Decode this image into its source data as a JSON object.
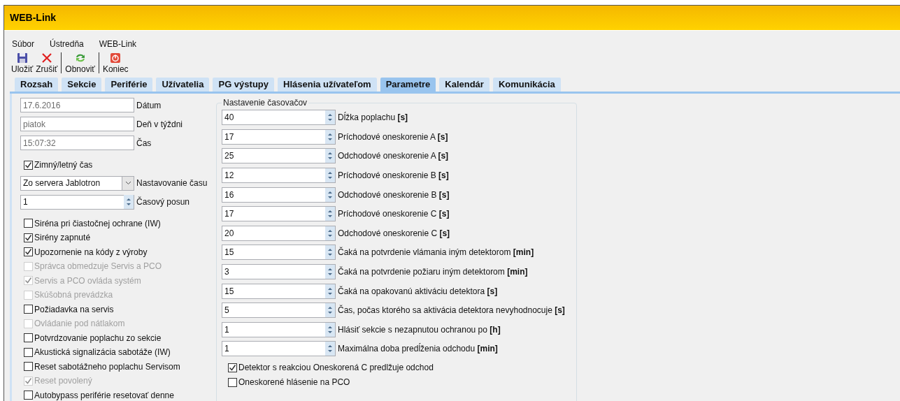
{
  "window": {
    "title": "WEB-Link"
  },
  "menu": [
    "Súbor",
    "Ústredňa",
    "WEB-Link"
  ],
  "toolbar": [
    {
      "kind": "save",
      "label": "Uložiť"
    },
    {
      "kind": "cancel",
      "label": "Zrušiť"
    },
    {
      "kind": "refresh",
      "label": "Obnoviť"
    },
    {
      "kind": "exit",
      "label": "Koniec"
    }
  ],
  "tabs": [
    {
      "label": "Rozsah",
      "selected": false
    },
    {
      "label": "Sekcie",
      "selected": false
    },
    {
      "label": "Periférie",
      "selected": false
    },
    {
      "label": "Užívatelia",
      "selected": false
    },
    {
      "label": "PG výstupy",
      "selected": false
    },
    {
      "label": "Hlásenia užívateľom",
      "selected": false
    },
    {
      "label": "Parametre",
      "selected": true
    },
    {
      "label": "Kalendár",
      "selected": false
    },
    {
      "label": "Komunikácia",
      "selected": false
    }
  ],
  "left": {
    "fields": [
      {
        "value": "17.6.2016",
        "label": "Dátum",
        "disabled": true
      },
      {
        "value": "piatok",
        "label": "Deň v týždni",
        "disabled": true
      },
      {
        "value": "15:07:32",
        "label": "Čas",
        "disabled": true
      }
    ],
    "dst": {
      "label": "Zimný/letný čas",
      "checked": true
    },
    "time_sync": {
      "value": "Zo servera Jablotron",
      "label": "Nastavovanie času"
    },
    "time_offset": {
      "value": "1",
      "label": "Časový posun"
    },
    "options": [
      {
        "kind": "checkbox",
        "label": "Siréna pri čiastočnej ochrane (IW)",
        "checked": false,
        "disabled": false
      },
      {
        "kind": "checkbox",
        "label": "Sirény zapnuté",
        "checked": true,
        "disabled": false
      },
      {
        "kind": "checkbox",
        "label": "Upozornenie na kódy z výroby",
        "checked": true,
        "disabled": false
      },
      {
        "kind": "checkbox",
        "label": "Správca obmedzuje Servis a PCO",
        "checked": false,
        "disabled": true
      },
      {
        "kind": "checkbox",
        "label": "Servis a PCO ovláda systém",
        "checked": true,
        "disabled": true
      },
      {
        "kind": "checkbox",
        "label": "Skúšobná prevádzka",
        "checked": false,
        "disabled": true
      },
      {
        "kind": "checkbox",
        "label": "Požiadavka na servis",
        "checked": false,
        "disabled": false
      },
      {
        "kind": "checkbox",
        "label": "Ovládanie pod nátlakom",
        "checked": false,
        "disabled": true
      },
      {
        "kind": "checkbox",
        "label": "Potvrdzovanie poplachu zo sekcie",
        "checked": false,
        "disabled": false
      },
      {
        "kind": "checkbox",
        "label": "Akustická signalizácia sabotáže (IW)",
        "checked": false,
        "disabled": false
      },
      {
        "kind": "checkbox",
        "label": "Reset sabotážneho poplachu Servisom",
        "checked": false,
        "disabled": false
      },
      {
        "kind": "checkbox",
        "label": "Reset povolený",
        "checked": true,
        "disabled": true
      },
      {
        "kind": "checkbox",
        "label": "Autobypass periférie resetovať denne",
        "checked": false,
        "disabled": false
      }
    ]
  },
  "timers": {
    "title": "Nastavenie časovačov",
    "rows": [
      {
        "value": "40",
        "label": "Dĺžka poplachu **[s]**"
      },
      {
        "value": "17",
        "label": "Príchodové oneskorenie A **[s]**"
      },
      {
        "value": "25",
        "label": "Odchodové oneskorenie A **[s]**"
      },
      {
        "value": "12",
        "label": "Príchodové oneskorenie B **[s]**"
      },
      {
        "value": "16",
        "label": "Odchodové oneskorenie B **[s]**"
      },
      {
        "value": "17",
        "label": "Príchodové oneskorenie C **[s]**"
      },
      {
        "value": "20",
        "label": "Odchodové oneskorenie C **[s]**"
      },
      {
        "value": "15",
        "label": "Čaká na potvrdenie vlámania iným detektorom **[min]**"
      },
      {
        "value": "3",
        "label": "Čaká na potvrdenie požiaru iným detektorom **[min]**"
      },
      {
        "value": "15",
        "label": "Čaká na opakovanú aktiváciu detektora **[s]**"
      },
      {
        "value": "5",
        "label": "Čas, počas ktorého sa aktivácia detektora nevyhodnocuje **[s]**"
      },
      {
        "value": "1",
        "label": "Hlásiť sekcie s nezapnutou ochranou po **[h]**"
      },
      {
        "value": "1",
        "label": "Maximálna doba predĺženia odchodu **[min]**"
      }
    ],
    "checks": [
      {
        "label": "Detektor s reakciou Oneskorená C predlžuje odchod",
        "checked": true
      },
      {
        "label": "Oneskorené hlásenie na PCO",
        "checked": false
      }
    ]
  }
}
